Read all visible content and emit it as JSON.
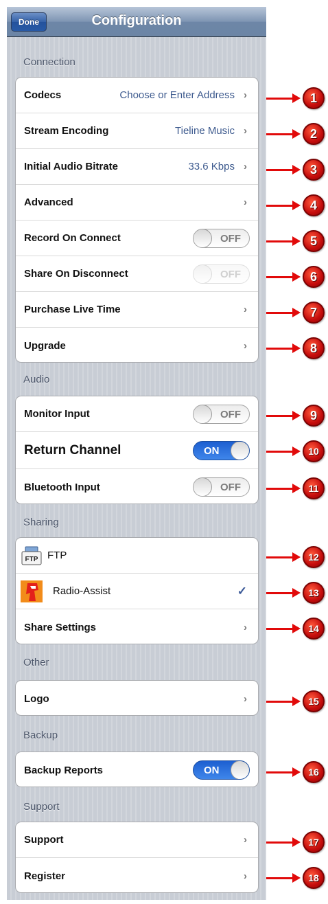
{
  "navbar": {
    "done_label": "Done",
    "title": "Configuration"
  },
  "connection": {
    "title": "Connection",
    "codecs": {
      "label": "Codecs",
      "value": "Choose or Enter Address"
    },
    "stream_encoding": {
      "label": "Stream Encoding",
      "value": "Tieline Music"
    },
    "initial_bitrate": {
      "label": "Initial Audio Bitrate",
      "value": "33.6 Kbps"
    },
    "advanced": {
      "label": "Advanced"
    },
    "record_on_connect": {
      "label": "Record On Connect",
      "state": "OFF"
    },
    "share_on_disconnect": {
      "label": "Share On Disconnect",
      "state": "OFF"
    },
    "purchase_live_time": {
      "label": "Purchase Live Time"
    },
    "upgrade": {
      "label": "Upgrade"
    }
  },
  "audio": {
    "title": "Audio",
    "monitor_input": {
      "label": "Monitor Input",
      "state": "OFF"
    },
    "return_channel": {
      "label": "Return Channel",
      "state": "ON"
    },
    "bluetooth_input": {
      "label": "Bluetooth Input",
      "state": "OFF"
    }
  },
  "sharing": {
    "title": "Sharing",
    "ftp": {
      "label": "FTP",
      "icon_text": "FTP"
    },
    "radio_assist": {
      "label": "Radio-Assist"
    },
    "share_settings": {
      "label": "Share Settings"
    }
  },
  "other": {
    "title": "Other",
    "logo": {
      "label": "Logo"
    }
  },
  "backup": {
    "title": "Backup",
    "backup_reports": {
      "label": "Backup Reports",
      "state": "ON"
    }
  },
  "support": {
    "title": "Support",
    "support_item": {
      "label": "Support"
    },
    "register": {
      "label": "Register"
    }
  },
  "callouts": [
    "1",
    "2",
    "3",
    "4",
    "5",
    "6",
    "7",
    "8",
    "9",
    "10",
    "11",
    "12",
    "13",
    "14",
    "15",
    "16",
    "17",
    "18"
  ],
  "colors": {
    "accent": "#e10a0a",
    "toggle_on": "#2a6fdd",
    "value_text": "#3d5a8e",
    "navbar": "#6d86a7"
  }
}
